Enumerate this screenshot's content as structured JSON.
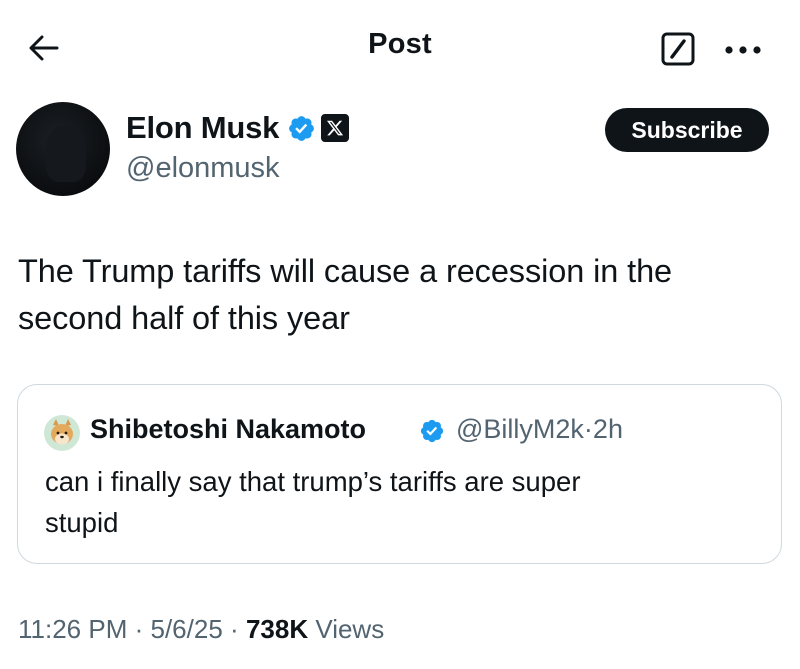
{
  "header": {
    "title": "Post",
    "back_icon": "arrow-left-icon",
    "grok_icon": "grok-slash-icon",
    "more_icon": "more-horizontal-icon"
  },
  "author": {
    "name": "Elon Musk",
    "handle": "@elonmusk",
    "verified": true,
    "affiliate_badge": "x-logo-icon",
    "subscribe_label": "Subscribe"
  },
  "tweet": {
    "text_line1": "The Trump tariffs will cause a recession in the",
    "text_line2": "second half of this year"
  },
  "quote": {
    "name": "Shibetoshi Nakamoto",
    "verified": true,
    "handle": "@BillyM2k",
    "separator": "·",
    "age": "2h",
    "text_line1": "can i finally say that trump’s tariffs are super",
    "text_line2": "stupid"
  },
  "meta": {
    "time": "11:26 PM",
    "sep1": "·",
    "date": "5/6/25",
    "sep2": "·",
    "views_count": "738K",
    "views_label": "Views"
  },
  "colors": {
    "text_primary": "#0f1419",
    "text_secondary": "#536471",
    "verified_blue": "#1d9bf0",
    "border": "#cfd9de",
    "subscribe_bg": "#0f1419"
  }
}
